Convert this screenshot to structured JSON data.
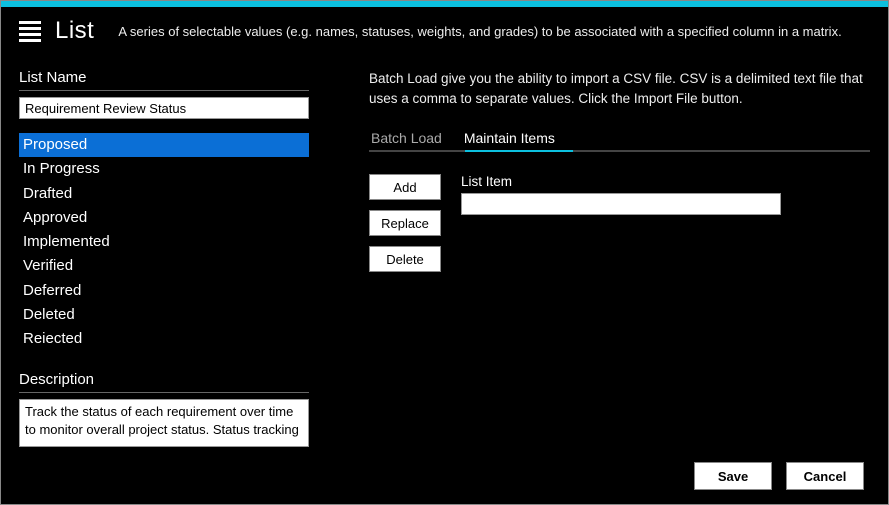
{
  "header": {
    "title": "List",
    "subtitle": "A series of selectable values (e.g. names, statuses, weights, and grades) to be associated with a specified column in a matrix."
  },
  "left": {
    "listNameLabel": "List Name",
    "listNameValue": "Requirement Review Status",
    "items": [
      "Proposed",
      "In Progress",
      "Drafted",
      "Approved",
      "Implemented",
      "Verified",
      "Deferred",
      "Deleted",
      "Rejected"
    ],
    "selectedIndex": 0,
    "descriptionLabel": "Description",
    "descriptionValue": "Track the status of each requirement over time to monitor overall project status. Status tracking"
  },
  "right": {
    "info": "Batch Load give you the ability to import a CSV file. CSV is a delimited text file that uses a comma to separate values. Click the Import File button.",
    "tabs": {
      "batchLoad": "Batch Load",
      "maintainItems": "Maintain Items",
      "active": "maintainItems"
    },
    "buttons": {
      "add": "Add",
      "replace": "Replace",
      "delete": "Delete"
    },
    "listItemLabel": "List Item",
    "listItemValue": ""
  },
  "footer": {
    "save": "Save",
    "cancel": "Cancel"
  }
}
